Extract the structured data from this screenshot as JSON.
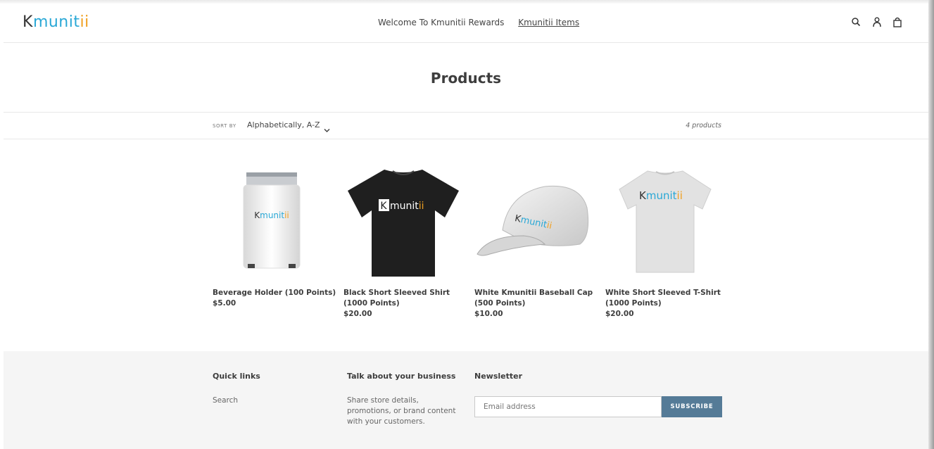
{
  "header": {
    "logo": {
      "k": "K",
      "middle": "munit",
      "end": "ii"
    },
    "nav": [
      "Welcome To Kmunitii Rewards",
      "Kmunitii Items"
    ],
    "icons": [
      "search-icon",
      "account-icon",
      "cart-icon"
    ]
  },
  "page": {
    "title": "Products"
  },
  "sort": {
    "label": "SORT BY",
    "value": "Alphabetically, A-Z",
    "count": "4 products"
  },
  "products": [
    {
      "name1": "Beverage Holder (100 Points)",
      "name2": "",
      "price": "$5.00",
      "logo": "Kmunitii"
    },
    {
      "name1": "Black Short Sleeved Shirt",
      "name2": "(1000 Points)",
      "price": "$20.00",
      "logo": "Kmunitii"
    },
    {
      "name1": "White Kmunitii Baseball Cap",
      "name2": "(500 Points)",
      "price": "$10.00",
      "logo": "Kmunitii"
    },
    {
      "name1": "White Short Sleeved T-Shirt",
      "name2": "(1000 Points)",
      "price": "$20.00",
      "logo": "Kmunitii"
    }
  ],
  "footer": {
    "quick_links": {
      "heading": "Quick links",
      "items": [
        "Search"
      ]
    },
    "business": {
      "heading": "Talk about your business",
      "line1": "Share store details,",
      "line2": "promotions, or brand content",
      "line3": "with your customers."
    },
    "newsletter": {
      "heading": "Newsletter",
      "placeholder": "Email address",
      "button": "SUBSCRIBE"
    }
  },
  "colors": {
    "brand_blue": "#2aa8d6",
    "brand_orange": "#f0a020",
    "button": "#557b97"
  }
}
